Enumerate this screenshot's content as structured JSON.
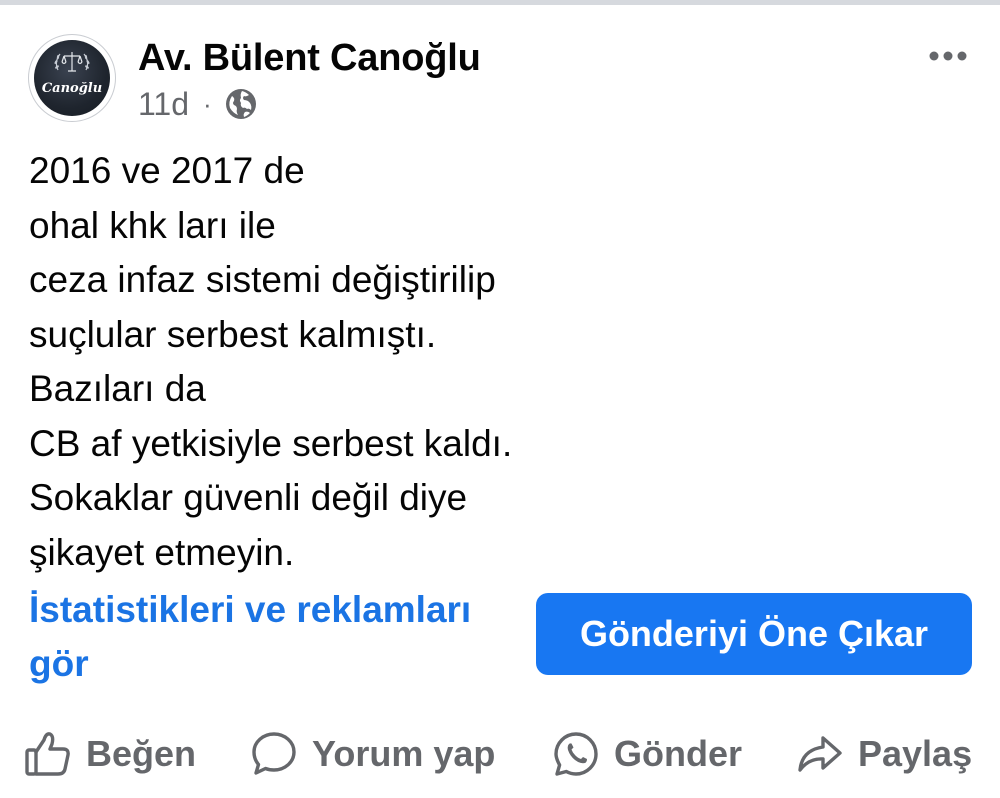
{
  "post": {
    "author": "Av. Bülent Canoğlu",
    "avatar_text": "Canoğlu",
    "time": "11d",
    "separator": "·",
    "audience_icon": "globe-icon",
    "more_icon": "more-horizontal-icon",
    "lines": [
      "2016 ve 2017 de",
      "ohal khk ları ile",
      "ceza infaz sistemi değiştirilip",
      "suçlular serbest kalmıştı.",
      "Bazıları da",
      "CB af yetkisiyle serbest kaldı.",
      "Sokaklar güvenli değil diye",
      "şikayet etmeyin."
    ]
  },
  "insights": {
    "link": "İstatistikleri ve reklamları gör"
  },
  "boost": {
    "label": "Gönderiyi Öne Çıkar"
  },
  "actions": {
    "like": {
      "label": "Beğen",
      "icon": "thumbs-up-icon"
    },
    "comment": {
      "label": "Yorum yap",
      "icon": "comment-bubble-icon"
    },
    "send": {
      "label": "Gönder",
      "icon": "whatsapp-icon"
    },
    "share": {
      "label": "Paylaş",
      "icon": "share-arrow-icon"
    }
  },
  "colors": {
    "link": "#1b74e4",
    "button": "#1877f2",
    "secondary_text": "#65676b",
    "primary_text": "#050505"
  }
}
